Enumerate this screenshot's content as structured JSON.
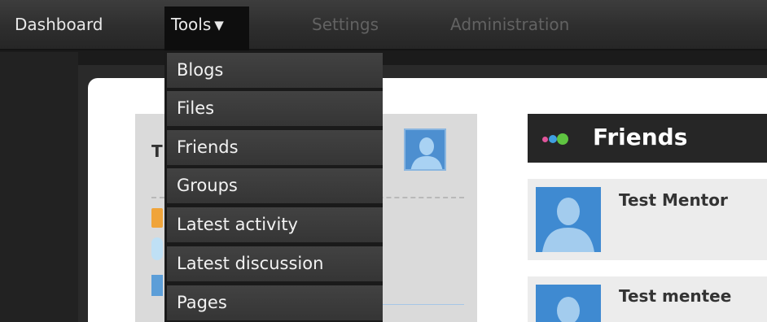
{
  "nav": {
    "dashboard": "Dashboard",
    "tools": "Tools",
    "tools_caret": "▼",
    "settings": "Settings",
    "administration": "Administration"
  },
  "tools_menu": {
    "items": [
      "Blogs",
      "Files",
      "Friends",
      "Groups",
      "Latest activity",
      "Latest discussion",
      "Pages"
    ]
  },
  "owner_block": {
    "initial": "T"
  },
  "friends_widget": {
    "title": "Friends",
    "friends": [
      {
        "name": "Test Mentor"
      },
      {
        "name": "Test mentee"
      }
    ]
  },
  "colors": {
    "accent_blue": "#3f8ad1",
    "dot_pink": "#e0559a",
    "dot_blue": "#3f9fe0",
    "dot_green": "#5fc441"
  },
  "icons": [
    "user-avatar-icon",
    "rss-feed-icon",
    "chevron-down-icon",
    "friends-dots-icon"
  ]
}
